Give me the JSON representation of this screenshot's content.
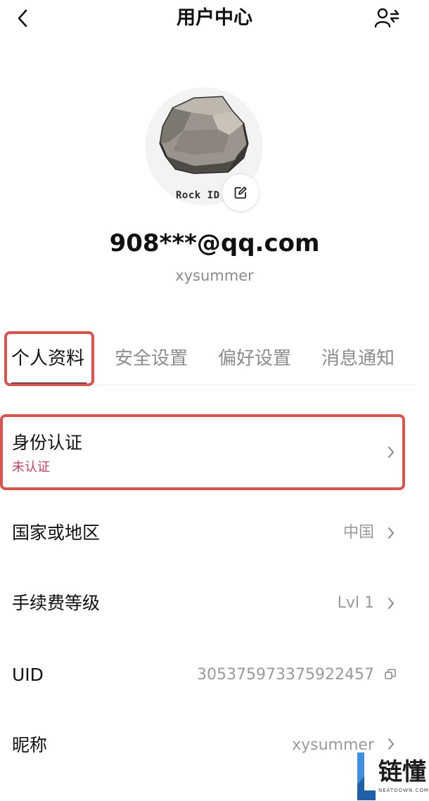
{
  "header": {
    "title": "用户中心",
    "back_icon": "chevron-left-icon",
    "right_icon": "user-switch-icon"
  },
  "profile": {
    "avatar_caption": "Rock ID",
    "email": "908***@qq.com",
    "username": "xysummer"
  },
  "tabs": [
    {
      "label": "个人资料",
      "active": true
    },
    {
      "label": "安全设置",
      "active": false
    },
    {
      "label": "偏好设置",
      "active": false
    },
    {
      "label": "消息通知",
      "active": false
    }
  ],
  "rows": {
    "identity": {
      "label": "身份认证",
      "status": "未认证"
    },
    "region": {
      "label": "国家或地区",
      "value": "中国"
    },
    "fee_level": {
      "label": "手续费等级",
      "value": "Lvl 1"
    },
    "uid": {
      "label": "UID",
      "value": "305375973375922457"
    },
    "nickname": {
      "label": "昵称",
      "value": "xysummer"
    }
  },
  "watermark": {
    "text": "链懂",
    "sub": "NEATDOWN.COM"
  },
  "colors": {
    "highlight": "#d9534f",
    "status_unverified": "#c4425f",
    "secondary_text": "#9a9a9a"
  }
}
